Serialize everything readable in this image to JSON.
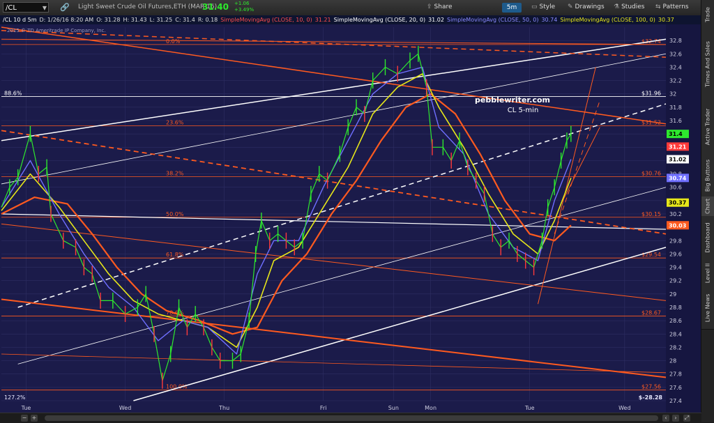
{
  "toolbar": {
    "symbol": "/CL",
    "instrument": "Light Sweet Crude Oil Futures,ETH (MAR 16)",
    "price": "31.40",
    "change_up": "+1.06",
    "change_pct": "+3.49%",
    "timeframe": "5m",
    "buttons": {
      "share": "Share",
      "style": "Style",
      "drawings": "Drawings",
      "studies": "Studies",
      "patterns": "Patterns"
    }
  },
  "colors": {
    "background": "#1b1b4a",
    "grid": "#2e2e63",
    "orange": "#ff5a1f",
    "white": "#ffffff",
    "blue": "#6f6fff",
    "yellow": "#e6e61a",
    "up": "#2ee82e",
    "down": "#ff3a3a"
  },
  "sidebar": {
    "tabs": [
      "Trade",
      "Times And Sales",
      "Active Trader",
      "Big Buttons",
      "Chart",
      "Dashboard",
      "Level II",
      "Live News"
    ]
  },
  "infobar": {
    "symbol": "/CL 10 d 5m",
    "date": "D: 1/26/16 8:20 AM",
    "open": "O: 31.28",
    "high": "H: 31.43",
    "low": "L: 31.25",
    "close": "C: 31.4",
    "range": "R: 0.18",
    "sma10": "SimpleMovingAvg (CLOSE, 10, 0)",
    "sma10_val": "31.21",
    "sma20": "SimpleMovingAvg (CLOSE, 20, 0)",
    "sma20_val": "31.02",
    "sma50": "SimpleMovingAvg (CLOSE, 50, 0)",
    "sma50_val": "30.74",
    "sma100": "SimpleMovingAvg (CLOSE, 100, 0)",
    "sma100_val": "30.37"
  },
  "chart_data": {
    "type": "line",
    "copyright": "2015 © TD Ameritrade IP Company, Inc.",
    "annotation": [
      "pebblewriter.com",
      "CL 5-min"
    ],
    "ylim": [
      27.4,
      33.0
    ],
    "y_ticks": [
      "32.8",
      "32.6",
      "32.4",
      "32.2",
      "32",
      "31.8",
      "31.6",
      "31.4",
      "31.2",
      "31",
      "30.8",
      "30.6",
      "30.4",
      "30.2",
      "30",
      "29.8",
      "29.6",
      "29.4",
      "29.2",
      "29",
      "28.8",
      "28.6",
      "28.4",
      "28.2",
      "28",
      "27.8",
      "27.6",
      "27.4"
    ],
    "x_labels": [
      {
        "label": "Tue",
        "x": 0.3
      },
      {
        "label": "Wed",
        "x": 1.5
      },
      {
        "label": "Thu",
        "x": 2.7
      },
      {
        "label": "Fri",
        "x": 3.9
      },
      {
        "label": "Sun",
        "x": 4.75
      },
      {
        "label": "Mon",
        "x": 5.2
      },
      {
        "label": "Tue",
        "x": 6.4
      },
      {
        "label": "Wed",
        "x": 7.55
      }
    ],
    "xlim": [
      0,
      8.05
    ],
    "close": [
      {
        "x": 0,
        "y": 30.3
      },
      {
        "x": 0.1,
        "y": 30.6
      },
      {
        "x": 0.2,
        "y": 30.75
      },
      {
        "x": 0.35,
        "y": 31.4
      },
      {
        "x": 0.45,
        "y": 30.8
      },
      {
        "x": 0.55,
        "y": 30.9
      },
      {
        "x": 0.6,
        "y": 30.2
      },
      {
        "x": 0.75,
        "y": 29.8
      },
      {
        "x": 0.9,
        "y": 29.7
      },
      {
        "x": 1.0,
        "y": 29.4
      },
      {
        "x": 1.1,
        "y": 29.3
      },
      {
        "x": 1.2,
        "y": 28.9
      },
      {
        "x": 1.35,
        "y": 28.9
      },
      {
        "x": 1.5,
        "y": 28.7
      },
      {
        "x": 1.65,
        "y": 28.8
      },
      {
        "x": 1.75,
        "y": 29.0
      },
      {
        "x": 1.85,
        "y": 28.4
      },
      {
        "x": 1.95,
        "y": 27.7
      },
      {
        "x": 2.05,
        "y": 28.1
      },
      {
        "x": 2.15,
        "y": 28.8
      },
      {
        "x": 2.25,
        "y": 28.5
      },
      {
        "x": 2.35,
        "y": 28.7
      },
      {
        "x": 2.45,
        "y": 28.5
      },
      {
        "x": 2.55,
        "y": 28.2
      },
      {
        "x": 2.65,
        "y": 28.0
      },
      {
        "x": 2.8,
        "y": 28.0
      },
      {
        "x": 2.9,
        "y": 28.1
      },
      {
        "x": 3.0,
        "y": 28.6
      },
      {
        "x": 3.08,
        "y": 29.6
      },
      {
        "x": 3.15,
        "y": 30.1
      },
      {
        "x": 3.25,
        "y": 29.8
      },
      {
        "x": 3.35,
        "y": 29.9
      },
      {
        "x": 3.45,
        "y": 29.8
      },
      {
        "x": 3.55,
        "y": 29.7
      },
      {
        "x": 3.65,
        "y": 29.8
      },
      {
        "x": 3.75,
        "y": 30.5
      },
      {
        "x": 3.85,
        "y": 30.8
      },
      {
        "x": 3.95,
        "y": 30.7
      },
      {
        "x": 4.1,
        "y": 31.1
      },
      {
        "x": 4.2,
        "y": 31.5
      },
      {
        "x": 4.3,
        "y": 31.8
      },
      {
        "x": 4.4,
        "y": 31.7
      },
      {
        "x": 4.5,
        "y": 32.2
      },
      {
        "x": 4.65,
        "y": 32.4
      },
      {
        "x": 4.8,
        "y": 32.3
      },
      {
        "x": 4.95,
        "y": 32.5
      },
      {
        "x": 5.05,
        "y": 32.6
      },
      {
        "x": 5.15,
        "y": 32.1
      },
      {
        "x": 5.22,
        "y": 31.2
      },
      {
        "x": 5.35,
        "y": 31.2
      },
      {
        "x": 5.45,
        "y": 31.0
      },
      {
        "x": 5.55,
        "y": 31.3
      },
      {
        "x": 5.65,
        "y": 30.9
      },
      {
        "x": 5.75,
        "y": 30.7
      },
      {
        "x": 5.85,
        "y": 30.5
      },
      {
        "x": 5.95,
        "y": 29.9
      },
      {
        "x": 6.05,
        "y": 29.7
      },
      {
        "x": 6.15,
        "y": 29.8
      },
      {
        "x": 6.25,
        "y": 29.6
      },
      {
        "x": 6.35,
        "y": 29.5
      },
      {
        "x": 6.45,
        "y": 29.4
      },
      {
        "x": 6.55,
        "y": 29.8
      },
      {
        "x": 6.62,
        "y": 30.3
      },
      {
        "x": 6.7,
        "y": 30.6
      },
      {
        "x": 6.78,
        "y": 31.0
      },
      {
        "x": 6.85,
        "y": 31.3
      },
      {
        "x": 6.9,
        "y": 31.4
      }
    ],
    "sma50": [
      {
        "x": 0,
        "y": 30.25
      },
      {
        "x": 0.35,
        "y": 30.8
      },
      {
        "x": 0.7,
        "y": 30.3
      },
      {
        "x": 1.0,
        "y": 29.8
      },
      {
        "x": 1.3,
        "y": 29.3
      },
      {
        "x": 1.6,
        "y": 28.9
      },
      {
        "x": 1.9,
        "y": 28.7
      },
      {
        "x": 2.2,
        "y": 28.6
      },
      {
        "x": 2.5,
        "y": 28.5
      },
      {
        "x": 2.85,
        "y": 28.2
      },
      {
        "x": 3.1,
        "y": 28.8
      },
      {
        "x": 3.3,
        "y": 29.5
      },
      {
        "x": 3.6,
        "y": 29.7
      },
      {
        "x": 3.9,
        "y": 30.3
      },
      {
        "x": 4.2,
        "y": 30.9
      },
      {
        "x": 4.5,
        "y": 31.7
      },
      {
        "x": 4.8,
        "y": 32.1
      },
      {
        "x": 5.1,
        "y": 32.3
      },
      {
        "x": 5.3,
        "y": 31.8
      },
      {
        "x": 5.6,
        "y": 31.2
      },
      {
        "x": 5.9,
        "y": 30.5
      },
      {
        "x": 6.2,
        "y": 29.9
      },
      {
        "x": 6.5,
        "y": 29.6
      },
      {
        "x": 6.7,
        "y": 30.1
      },
      {
        "x": 6.9,
        "y": 30.74
      }
    ],
    "sma100": [
      {
        "x": 0,
        "y": 30.2
      },
      {
        "x": 0.4,
        "y": 30.45
      },
      {
        "x": 0.8,
        "y": 30.35
      },
      {
        "x": 1.1,
        "y": 29.9
      },
      {
        "x": 1.4,
        "y": 29.4
      },
      {
        "x": 1.7,
        "y": 29.0
      },
      {
        "x": 2.0,
        "y": 28.75
      },
      {
        "x": 2.4,
        "y": 28.6
      },
      {
        "x": 2.8,
        "y": 28.4
      },
      {
        "x": 3.1,
        "y": 28.5
      },
      {
        "x": 3.4,
        "y": 29.2
      },
      {
        "x": 3.7,
        "y": 29.6
      },
      {
        "x": 4.0,
        "y": 30.2
      },
      {
        "x": 4.3,
        "y": 30.7
      },
      {
        "x": 4.6,
        "y": 31.3
      },
      {
        "x": 4.9,
        "y": 31.8
      },
      {
        "x": 5.2,
        "y": 32.0
      },
      {
        "x": 5.5,
        "y": 31.7
      },
      {
        "x": 5.8,
        "y": 31.1
      },
      {
        "x": 6.1,
        "y": 30.4
      },
      {
        "x": 6.4,
        "y": 29.9
      },
      {
        "x": 6.7,
        "y": 29.8
      },
      {
        "x": 6.9,
        "y": 30.03
      }
    ],
    "sma20": [
      {
        "x": 0,
        "y": 30.3
      },
      {
        "x": 0.35,
        "y": 31.0
      },
      {
        "x": 0.7,
        "y": 30.2
      },
      {
        "x": 1.0,
        "y": 29.6
      },
      {
        "x": 1.3,
        "y": 29.1
      },
      {
        "x": 1.6,
        "y": 28.8
      },
      {
        "x": 1.9,
        "y": 28.3
      },
      {
        "x": 2.2,
        "y": 28.6
      },
      {
        "x": 2.5,
        "y": 28.5
      },
      {
        "x": 2.85,
        "y": 28.1
      },
      {
        "x": 3.1,
        "y": 29.3
      },
      {
        "x": 3.3,
        "y": 29.8
      },
      {
        "x": 3.6,
        "y": 29.8
      },
      {
        "x": 3.9,
        "y": 30.6
      },
      {
        "x": 4.2,
        "y": 31.3
      },
      {
        "x": 4.5,
        "y": 32.0
      },
      {
        "x": 4.8,
        "y": 32.3
      },
      {
        "x": 5.1,
        "y": 32.4
      },
      {
        "x": 5.3,
        "y": 31.5
      },
      {
        "x": 5.6,
        "y": 31.1
      },
      {
        "x": 5.9,
        "y": 30.2
      },
      {
        "x": 6.2,
        "y": 29.7
      },
      {
        "x": 6.5,
        "y": 29.5
      },
      {
        "x": 6.7,
        "y": 30.4
      },
      {
        "x": 6.9,
        "y": 31.02
      }
    ],
    "levels": [
      {
        "value": 32.74,
        "label": "$32.74",
        "fib": "0.0%"
      },
      {
        "value": 31.96,
        "label": "$31.96",
        "fib": "88.6%"
      },
      {
        "value": 31.52,
        "label": "$31.52",
        "fib": "23.6%"
      },
      {
        "value": 30.76,
        "label": "$30.76",
        "fib": "38.2%"
      },
      {
        "value": 30.15,
        "label": "$30.15",
        "fib": "50.0%"
      },
      {
        "value": 29.54,
        "label": "$29.54",
        "fib": "61.8%"
      },
      {
        "value": 28.67,
        "label": "$28.67",
        "fib": "78.6%"
      },
      {
        "value": 27.56,
        "label": "$27.56",
        "fib": "100.0%"
      }
    ],
    "price_tags": [
      {
        "value": 31.4,
        "label": "31.4",
        "bg": "#2ee82e",
        "fg": "#000000"
      },
      {
        "value": 31.21,
        "label": "31.21",
        "bg": "#ff3a3a",
        "fg": "#ffffff"
      },
      {
        "value": 31.02,
        "label": "31.02",
        "bg": "#ffffff",
        "fg": "#000000"
      },
      {
        "value": 30.74,
        "label": "30.74",
        "bg": "#6f6fff",
        "fg": "#ffffff"
      },
      {
        "value": 30.37,
        "label": "30.37",
        "bg": "#e6e61a",
        "fg": "#000000"
      },
      {
        "value": 30.03,
        "label": "30.03",
        "bg": "#ff5a1f",
        "fg": "#ffffff"
      }
    ],
    "bottom_left": "127.2%",
    "bottom_right": "$-28.28",
    "trendlines": [
      {
        "x1": 0,
        "y1": 31.3,
        "x2": 8.05,
        "y2": 32.82,
        "color": "#ffffff",
        "w": 1.5,
        "dash": false
      },
      {
        "x1": 0,
        "y1": 30.65,
        "x2": 8.05,
        "y2": 32.6,
        "color": "#ffffff",
        "w": 0.8,
        "dash": false
      },
      {
        "x1": 0.2,
        "y1": 28.8,
        "x2": 8.05,
        "y2": 31.85,
        "color": "#ffffff",
        "w": 1.5,
        "dash": true
      },
      {
        "x1": 0.2,
        "y1": 27.95,
        "x2": 8.05,
        "y2": 30.6,
        "color": "#ffffff",
        "w": 0.8,
        "dash": false
      },
      {
        "x1": 1.6,
        "y1": 27.4,
        "x2": 8.05,
        "y2": 29.7,
        "color": "#ffffff",
        "w": 1.5,
        "dash": false
      },
      {
        "x1": 0,
        "y1": 30.2,
        "x2": 8.05,
        "y2": 29.97,
        "color": "#ffffff",
        "w": 1.2,
        "dash": false
      },
      {
        "x1": 0,
        "y1": 32.95,
        "x2": 8.05,
        "y2": 32.55,
        "color": "#ff5a1f",
        "w": 1.5,
        "dash": true
      },
      {
        "x1": 0,
        "y1": 32.82,
        "x2": 8.05,
        "y2": 32.74,
        "color": "#ff5a1f",
        "w": 1,
        "dash": false
      },
      {
        "x1": 0,
        "y1": 33.0,
        "x2": 8.05,
        "y2": 31.55,
        "color": "#ff5a1f",
        "w": 1.5,
        "dash": false
      },
      {
        "x1": 0,
        "y1": 31.45,
        "x2": 8.05,
        "y2": 29.9,
        "color": "#ff5a1f",
        "w": 1.8,
        "dash": true
      },
      {
        "x1": 0,
        "y1": 30.05,
        "x2": 8.05,
        "y2": 28.9,
        "color": "#ff5a1f",
        "w": 1,
        "dash": false
      },
      {
        "x1": 0,
        "y1": 28.92,
        "x2": 8.05,
        "y2": 27.75,
        "color": "#ff5a1f",
        "w": 2,
        "dash": false
      },
      {
        "x1": 0,
        "y1": 28.1,
        "x2": 8.05,
        "y2": 27.82,
        "color": "#ff5a1f",
        "w": 0.8,
        "dash": false
      },
      {
        "x1": 6.5,
        "y1": 28.85,
        "x2": 7.2,
        "y2": 32.4,
        "color": "#ff5a1f",
        "w": 1,
        "dash": false
      },
      {
        "x1": 6.7,
        "y1": 29.9,
        "x2": 7.25,
        "y2": 31.9,
        "color": "#ff5a1f",
        "w": 1,
        "dash": true
      },
      {
        "x1": 6.8,
        "y1": 30.4,
        "x2": 7.25,
        "y2": 31.5,
        "color": "#ff5a1f",
        "w": 1,
        "dash": false
      }
    ]
  }
}
